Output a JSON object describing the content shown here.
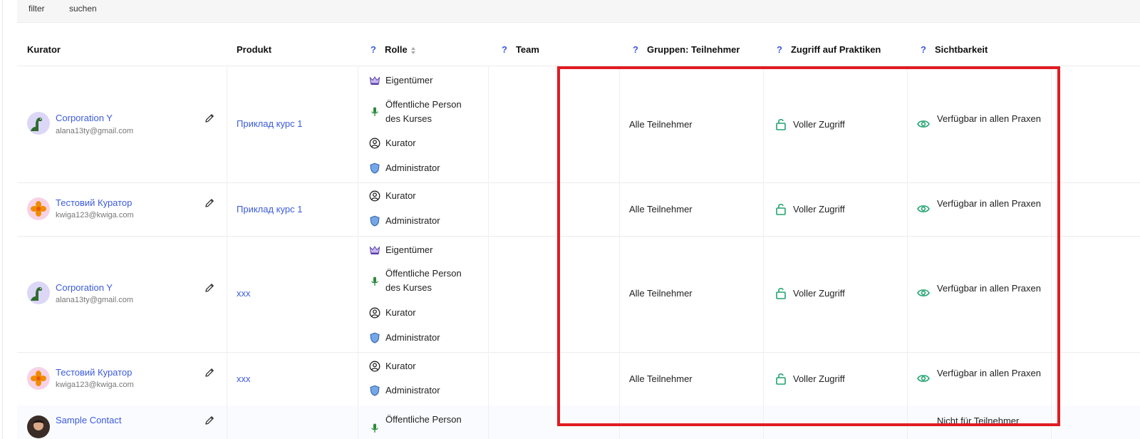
{
  "filter_bar": {
    "filter": "filter",
    "search": "suchen"
  },
  "columns": {
    "curator": "Kurator",
    "product": "Produkt",
    "role": "Rolle",
    "team": "Team",
    "groups": "Gruppen: Teilnehmer",
    "access": "Zugriff auf Praktiken",
    "visibility": "Sichtbarkeit",
    "help_mark": "?"
  },
  "rows": [
    {
      "curator": {
        "name": "Corporation Y",
        "email": "alana13ty@gmail.com",
        "avatar": "dinosaur"
      },
      "product": "Приклад курс 1",
      "roles": [
        "Eigentümer",
        "Öffentliche Person des Kurses",
        "Kurator",
        "Administrator"
      ],
      "groups": "Alle Teilnehmer",
      "access": "Voller Zugriff",
      "visibility": "Verfügbar in allen Praxen"
    },
    {
      "curator": {
        "name": "Тестовий Куратор",
        "email": "kwiga123@kwiga.com",
        "avatar": "flower"
      },
      "product": "Приклад курс 1",
      "roles": [
        "Kurator",
        "Administrator"
      ],
      "groups": "Alle Teilnehmer",
      "access": "Voller Zugriff",
      "visibility": "Verfügbar in allen Praxen"
    },
    {
      "curator": {
        "name": "Corporation Y",
        "email": "alana13ty@gmail.com",
        "avatar": "dinosaur"
      },
      "product": "xxx",
      "roles": [
        "Eigentümer",
        "Öffentliche Person des Kurses",
        "Kurator",
        "Administrator"
      ],
      "groups": "Alle Teilnehmer",
      "access": "Voller Zugriff",
      "visibility": "Verfügbar in allen Praxen"
    },
    {
      "curator": {
        "name": "Тестовий Куратор",
        "email": "kwiga123@kwiga.com",
        "avatar": "flower"
      },
      "product": "xxx",
      "roles": [
        "Kurator",
        "Administrator"
      ],
      "groups": "Alle Teilnehmer",
      "access": "Voller Zugriff",
      "visibility": "Verfügbar in allen Praxen"
    },
    {
      "curator": {
        "name": "Sample Contact",
        "avatar": "photo"
      },
      "roles": [
        "Öffentliche Person"
      ],
      "visibility": "Nicht für Teilnehmer"
    }
  ],
  "colors": {
    "link": "#3b5bdb",
    "icon_green": "#21a36f",
    "highlight": "#e11b22"
  }
}
